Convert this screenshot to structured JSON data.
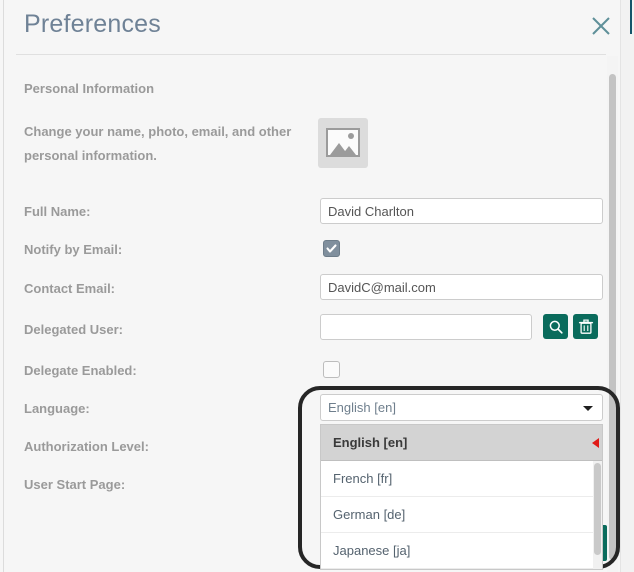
{
  "dialog": {
    "title": "Preferences",
    "close_icon": "close-icon"
  },
  "section": {
    "heading": "Personal Information",
    "description": "Change your name, photo, email, and other personal information."
  },
  "photo": {
    "icon": "image-placeholder-icon"
  },
  "fields": {
    "full_name": {
      "label": "Full Name:",
      "value": "David Charlton",
      "placeholder": ""
    },
    "notify_by_email": {
      "label": "Notify by Email:",
      "checked": true
    },
    "contact_email": {
      "label": "Contact Email:",
      "value": "DavidC@mail.com",
      "placeholder": ""
    },
    "delegated_user": {
      "label": "Delegated User:",
      "value": "",
      "placeholder": "",
      "search_icon": "search-icon",
      "delete_icon": "trash-icon"
    },
    "delegate_enabled": {
      "label": "Delegate Enabled:",
      "checked": false
    },
    "language": {
      "label": "Language:",
      "value": "English [en]",
      "arrow_icon": "chevron-down-icon",
      "options": [
        "English [en]",
        "French [fr]",
        "German [de]",
        "Japanese [ja]"
      ],
      "selected_index": 0
    },
    "authorization_level": {
      "label": "Authorization Level:"
    },
    "user_start_page": {
      "label": "User Start Page:"
    }
  },
  "colors": {
    "title": "#6f8296",
    "label": "#9a9a9a",
    "accent_green": "#0a6b5c",
    "checkbox": "#808f9d",
    "marker_red": "#e01b18",
    "highlight_ring": "#262626"
  }
}
